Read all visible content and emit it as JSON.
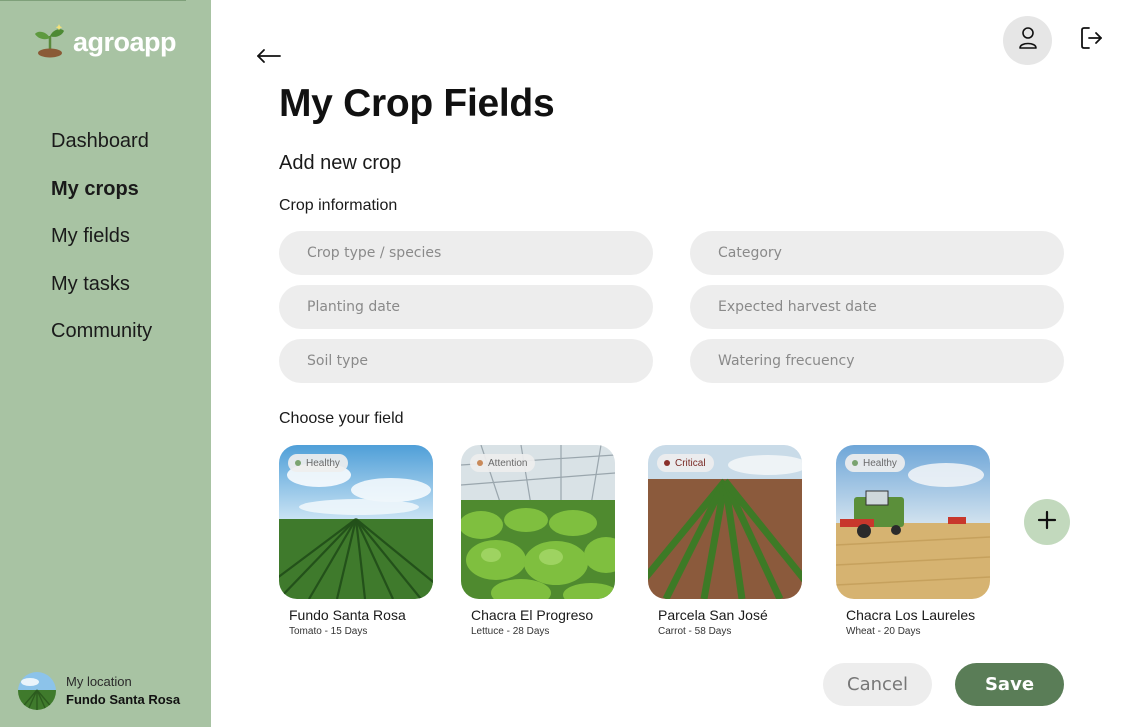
{
  "app": {
    "brand": "agroapp"
  },
  "sidebar": {
    "items": [
      {
        "label": "Dashboard",
        "active": false
      },
      {
        "label": "My crops",
        "active": true
      },
      {
        "label": "My fields",
        "active": false
      },
      {
        "label": "My tasks",
        "active": false
      },
      {
        "label": "Community",
        "active": false
      }
    ],
    "location": {
      "label": "My location",
      "value": "Fundo Santa Rosa"
    }
  },
  "header": {
    "back_icon": "arrow-left-icon",
    "user_icon": "user-icon",
    "logout_icon": "logout-icon"
  },
  "main": {
    "title": "My Crop Fields",
    "subtitle": "Add new crop",
    "crop_info_label": "Crop information",
    "fields": {
      "crop_type": "Crop type / species",
      "category": "Category",
      "planting_date": "Planting date",
      "harvest_date": "Expected harvest date",
      "soil_type": "Soil type",
      "watering": "Watering frecuency"
    },
    "choose_field_label": "Choose your field",
    "cards": [
      {
        "status": "Healthy",
        "status_color": "#7aa36f",
        "name": "Fundo Santa Rosa",
        "detail": "Tomato - 15 Days"
      },
      {
        "status": "Attention",
        "status_color": "#c98a5a",
        "name": "Chacra El Progreso",
        "detail": "Lettuce - 28 Days"
      },
      {
        "status": "Critical",
        "status_color": "#8a2f2a",
        "name": "Parcela San José",
        "detail": "Carrot - 58 Days"
      },
      {
        "status": "Healthy",
        "status_color": "#7aa36f",
        "name": "Chacra Los Laureles",
        "detail": "Wheat - 20 Days"
      }
    ],
    "add_icon": "plus-icon"
  },
  "actions": {
    "cancel": "Cancel",
    "save": "Save"
  },
  "colors": {
    "sidebar": "#a8c3a3",
    "primary": "#5a7d57",
    "add_button": "#c2d9bd",
    "input_bg": "#ededed"
  }
}
